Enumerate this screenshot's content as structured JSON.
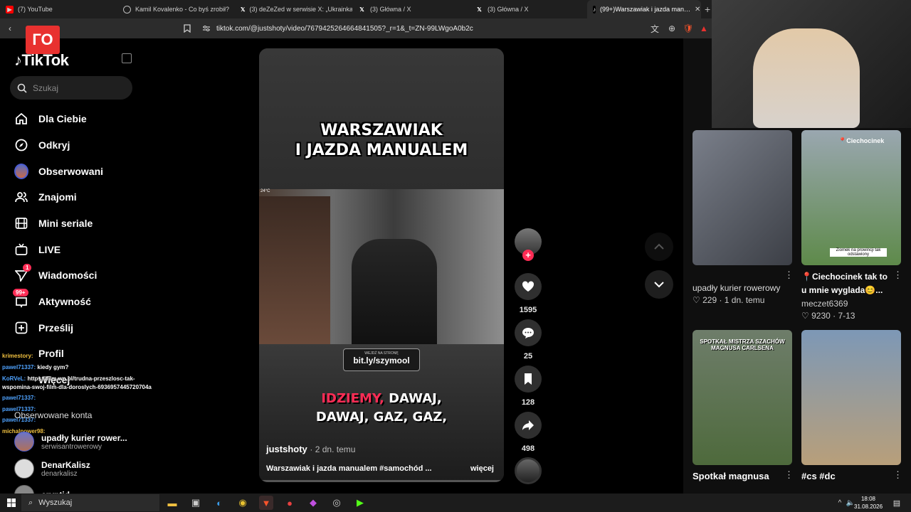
{
  "tabs": [
    {
      "label": "(7) YouTube",
      "icon": "youtube-icon"
    },
    {
      "label": "Kamil Kovalenko - Co byś zrobił?",
      "icon": "globe-icon"
    },
    {
      "label": "(3) deZeZed w serwisie X: „Ukrainka n…",
      "icon": "x-icon"
    },
    {
      "label": "(3) Główna / X",
      "icon": "x-icon"
    },
    {
      "label": "(3) Główna / X",
      "icon": "x-icon"
    },
    {
      "label": "(99+)Warszawiak i jazda man…",
      "icon": "tiktok-icon"
    }
  ],
  "address": {
    "url": "tiktok.com/@justshoty/video/7679425264664841505?_r=1&_t=ZN-99LWgoA0b2c"
  },
  "overlay_logo": "ГО",
  "brand": {
    "name": "TikTok",
    "accent": "#fe2c55"
  },
  "search": {
    "placeholder": "Szukaj"
  },
  "nav": [
    {
      "label": "Dla Ciebie",
      "icon": "home-icon"
    },
    {
      "label": "Odkryj",
      "icon": "compass-icon"
    },
    {
      "label": "Obserwowani",
      "icon": "avatar-icon"
    },
    {
      "label": "Znajomi",
      "icon": "friends-icon"
    },
    {
      "label": "Mini seriale",
      "icon": "film-icon"
    },
    {
      "label": "LIVE",
      "icon": "live-tv-icon"
    },
    {
      "label": "Wiadomości",
      "icon": "send-icon",
      "badge": "1"
    },
    {
      "label": "Aktywność",
      "icon": "inbox-icon",
      "badge": "99+"
    },
    {
      "label": "Prześlij",
      "icon": "upload-icon"
    },
    {
      "label": "Profil",
      "icon": "profile-icon"
    },
    {
      "label": "Więcej",
      "icon": "more-icon"
    }
  ],
  "chat": [
    {
      "user": "krimestory:",
      "text": ""
    },
    {
      "user": "pawel71337:",
      "text": "kiedy gym?"
    },
    {
      "user": "KoRVeL:",
      "text": "https://film.wp.pl/trudna-przeszlosc-tak-"
    },
    {
      "user": "",
      "text": "wspomina-swoj-film-dla-doroslych-6936957445720704a"
    },
    {
      "user": "pawel71337:",
      "text": ""
    },
    {
      "user": "pawel71337:",
      "text": ""
    },
    {
      "user": "pawel71337:",
      "text": ""
    },
    {
      "user": "michalpower98:",
      "text": ""
    }
  ],
  "followed": {
    "heading": "Obserwowane konta",
    "items": [
      {
        "name": "upadły kurier rower...",
        "handle": "serwisantrowerowy"
      },
      {
        "name": "DenarKalisz",
        "handle": "denarkalisz"
      },
      {
        "name": "cryptid",
        "handle": ""
      }
    ]
  },
  "video": {
    "title_line1": "WARSZAWIAK",
    "title_line2": "I JAZDA MANUALEM",
    "temp": "24°C",
    "banner_small": "WEJDŹ NA STRONĘ",
    "banner_link": "bit.ly/szymool",
    "subtitle_red": "IDZIEMY,",
    "subtitle_rest1": " DAWAJ,",
    "subtitle_line2": "DAWAJ, GAZ, GAZ,",
    "author": "justshoty",
    "posted": "· 2 dn. temu",
    "description": "Warszawiak i jazda manualem #samochód ...",
    "more": "więcej"
  },
  "actions": {
    "likes": "1595",
    "comments": "25",
    "saves": "128",
    "shares": "498"
  },
  "recommended": [
    {
      "caption": "upadły kurier rowerowy",
      "meta": "♡ 229 · 1 dn. temu",
      "overlay": ""
    },
    {
      "caption": "📍Ciechocinek tak to u mnie wygladа😊...",
      "meta": "♡ 9230 · 7-13",
      "author": "meczet6369",
      "overlay": "📍Ciechocinek",
      "overlay2": "Ziomek na prowincji tak odstawiony"
    },
    {
      "caption": "Spotkał magnusa",
      "meta": "",
      "overlay": "SPOTKAŁ MISTRZA SZACHÓW MAGNUSA CARLSENA"
    },
    {
      "caption": "#cs #dc",
      "meta": "",
      "overlay": ""
    }
  ],
  "taskbar": {
    "search": "Wyszukaj",
    "time": "18:08",
    "date": "31.08.2026"
  }
}
